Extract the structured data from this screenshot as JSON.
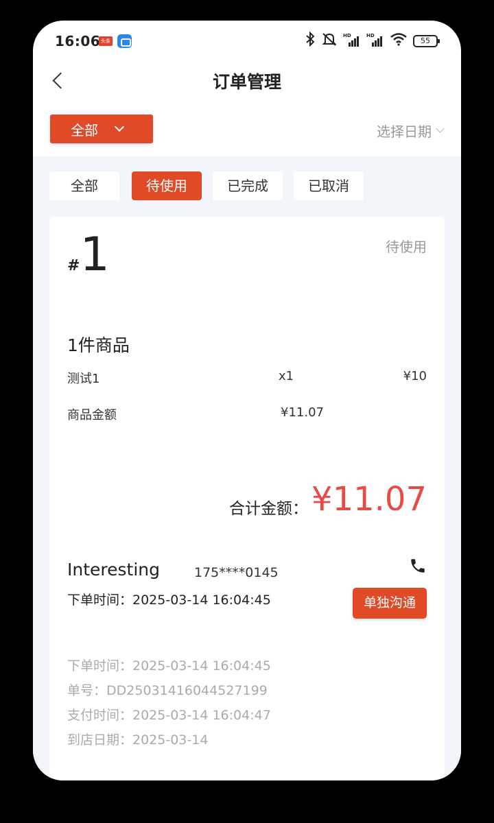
{
  "status_bar": {
    "time": "16:06",
    "app_badge": "头条",
    "battery": "55",
    "icons": [
      "bluetooth-icon",
      "mute-icon",
      "signal-hd-icon",
      "signal-hd-icon",
      "wifi-icon",
      "battery-icon"
    ]
  },
  "header": {
    "title": "订单管理",
    "back_icon": "chevron-left-icon"
  },
  "filters": {
    "category_dropdown": "全部",
    "date_select": "选择日期"
  },
  "tabs": [
    {
      "label": "全部",
      "active": false
    },
    {
      "label": "待使用",
      "active": true
    },
    {
      "label": "已完成",
      "active": false
    },
    {
      "label": "已取消",
      "active": false
    }
  ],
  "order": {
    "hash": "#",
    "number": "1",
    "status": "待使用",
    "goods_count": "1件商品",
    "items": [
      {
        "name": "测试1",
        "qty": "x1",
        "price": "¥10"
      }
    ],
    "subtotal_label": "商品金额",
    "subtotal_value": "¥11.07",
    "total_label": "合计金额：",
    "total_value": "¥11.07",
    "customer_name": "Interesting",
    "customer_phone": "175****0145",
    "order_time_main": "下单时间：2025-03-14 16:04:45",
    "contact_button": "单独沟通",
    "meta": [
      "下单时间：2025-03-14 16:04:45",
      "单号：DD25031416044527199",
      "支付时间：2025-03-14 16:04:47",
      "到店日期：2025-03-14"
    ]
  },
  "colors": {
    "accent": "#e04a27",
    "price_red": "#ea4a44",
    "background": "#f2f5fa"
  }
}
